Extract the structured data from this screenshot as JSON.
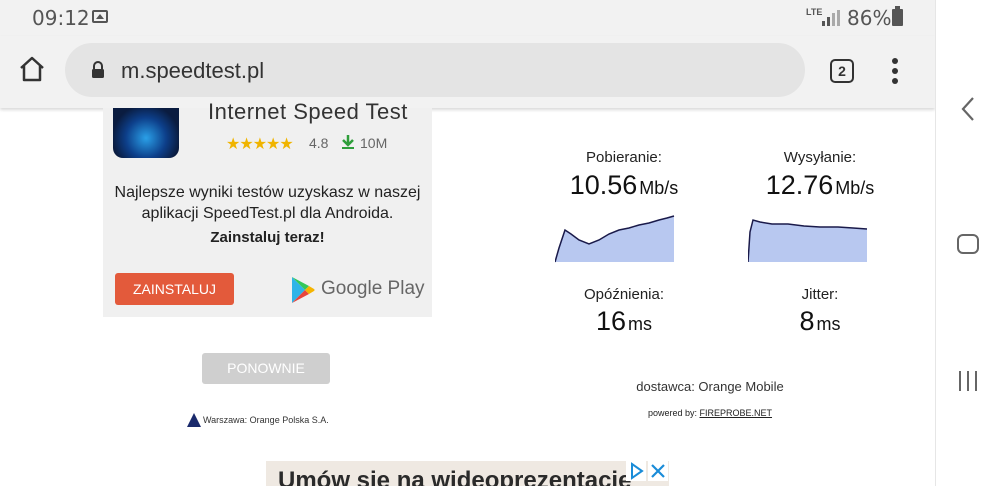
{
  "status_bar": {
    "time": "09:12",
    "network": "LTE",
    "battery": "86%"
  },
  "browser": {
    "url": "m.speedtest.pl",
    "tab_count": "2"
  },
  "ad_card": {
    "app_title": "Internet Speed Test",
    "stars": "★★★★★",
    "rating": "4.8",
    "downloads": "10M",
    "text": "Najlepsze wyniki testów uzyskasz w naszej aplikacji SpeedTest.pl dla Androida.",
    "cta": "Zainstaluj teraz!",
    "install_label": "ZAINSTALUJ",
    "store_label": "Google Play"
  },
  "retry_label": "PONOWNIE",
  "server": "Warszawa: Orange Polska S.A.",
  "results": {
    "download": {
      "label": "Pobieranie:",
      "value": "10.56",
      "unit": "Mb/s"
    },
    "upload": {
      "label": "Wysyłanie:",
      "value": "12.76",
      "unit": "Mb/s"
    },
    "ping": {
      "label": "Opóźnienia:",
      "value": "16",
      "unit": "ms"
    },
    "jitter": {
      "label": "Jitter:",
      "value": "8",
      "unit": "ms"
    }
  },
  "provider": "dostawca: Orange Mobile",
  "powered_prefix": "powered by: ",
  "powered_link": "FIREPROBE.NET",
  "bottom_ad_text": "Umów się na wideoprezentację",
  "colors": {
    "install": "#e35a3b",
    "graph_fill": "#b8c8f0",
    "graph_line": "#1a1a4a"
  }
}
